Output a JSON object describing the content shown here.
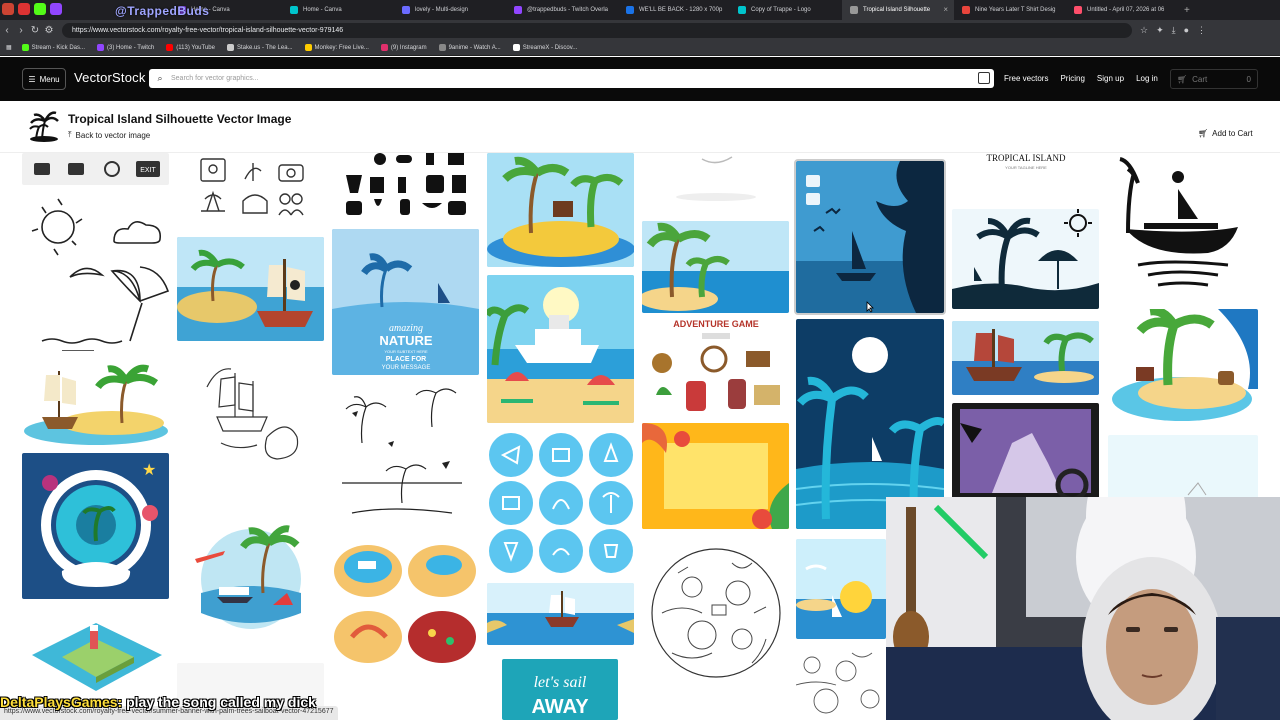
{
  "browser": {
    "overlay_text": "@TrappedBuds",
    "tabs": [
      {
        "title": "Home - Canva",
        "color": "#8b3dff"
      },
      {
        "title": "Home - Canva",
        "color": "#00c4cc"
      },
      {
        "title": "lovely - Multi-design",
        "color": "#6b6bff"
      },
      {
        "title": "@trappedbuds - Twitch Overla",
        "color": "#9146ff"
      },
      {
        "title": "WE'LL BE BACK - 1280 x 700p",
        "color": "#1a73e8"
      },
      {
        "title": "Copy of Trappe - Logo",
        "color": "#00c4cc"
      },
      {
        "title": "Tropical Island Silhouette",
        "color": "#999999",
        "active": true
      },
      {
        "title": "Nine Years Later T Shirt Desig",
        "color": "#e8453c"
      },
      {
        "title": "Untitled - April 07, 2026 at 06",
        "color": "#ff4f6b"
      }
    ],
    "url": "https://www.vectorstock.com/royalty-free-vector/tropical-island-silhouette-vector-979146",
    "bookmarks": [
      {
        "label": "Stream - Kick Das...",
        "color": "#53fc18"
      },
      {
        "label": "(3) Home - Twitch",
        "color": "#9146ff"
      },
      {
        "label": "(113) YouTube",
        "color": "#ff0000"
      },
      {
        "label": "Stake.us - The Lea...",
        "color": "#cccccc"
      },
      {
        "label": "Monkey: Free Live...",
        "color": "#ffcc00"
      },
      {
        "label": "(9) Instagram",
        "color": "#e1306c"
      },
      {
        "label": "9anime - Watch A...",
        "color": "#888888"
      },
      {
        "label": "StreameX - Discov...",
        "color": "#ffffff"
      }
    ]
  },
  "site": {
    "menu_label": "Menu",
    "logo": "VectorStock",
    "search_placeholder": "Search for vector graphics...",
    "nav": [
      "Free vectors",
      "Pricing",
      "Sign up",
      "Log in"
    ],
    "cart_label": "Cart",
    "cart_count": "0"
  },
  "product": {
    "title": "Tropical Island Silhouette Vector Image",
    "back_label": "Back to vector image",
    "add_to_cart": "Add to Cart"
  },
  "tiles": {
    "tropical_island_heading": "TROPICAL ISLAND",
    "tropical_island_tagline": "YOUR TAGLINE HERE",
    "amazing_nature": [
      "amazing",
      "NATURE",
      "YOUR SUBTEXT HERE",
      "PLACE FOR",
      "YOUR MESSAGE"
    ],
    "adventure_game": "ADVENTURE GAME",
    "lets_sail": [
      "let's sail",
      "AWAY"
    ],
    "exit_label": "EXIT"
  },
  "status": {
    "hover_url": "https://www.vectorstock.com/royalty-free-vector/summer-banner-with-palm-trees-sailboat-vector-47215677",
    "caption_user": "DeltaPlaysGames:",
    "caption_text": " play the song called my dick"
  }
}
